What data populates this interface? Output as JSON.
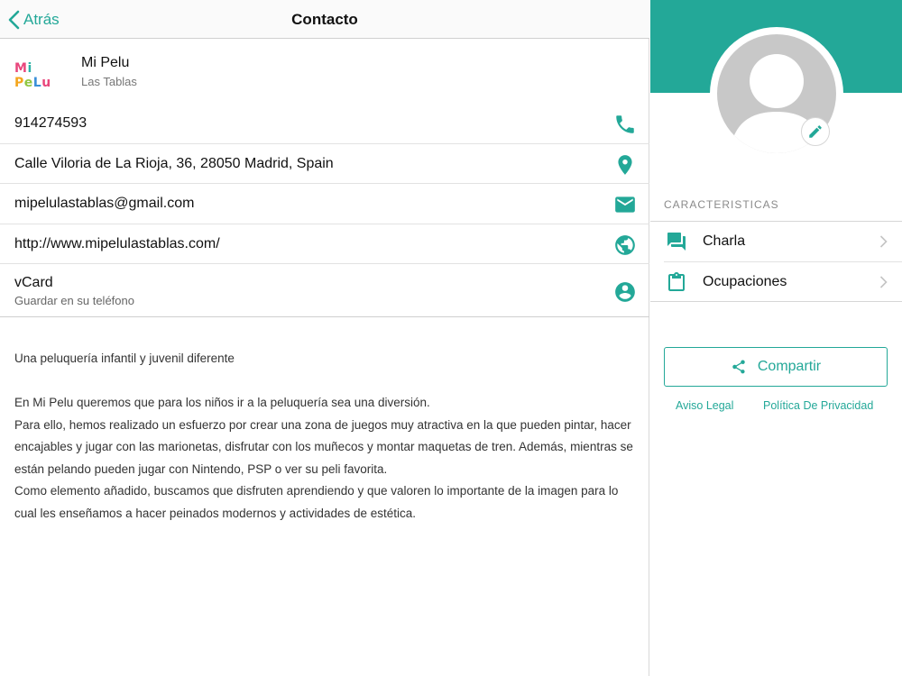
{
  "navbar": {
    "back_label": "Atrás",
    "title": "Contacto"
  },
  "business": {
    "logo_text": [
      "M",
      "i",
      " P",
      "e",
      "L",
      "u"
    ],
    "name": "Mi Pelu",
    "location": "Las Tablas"
  },
  "contact": {
    "phone": "914274593",
    "address": "Calle Viloria de La Rioja, 36, 28050 Madrid, Spain",
    "email": "mipelulastablas@gmail.com",
    "website": "http://www.mipelulastablas.com/",
    "vcard_title": "vCard",
    "vcard_sub": "Guardar en su teléfono"
  },
  "description": [
    "Una peluquería infantil y juvenil diferente",
    "En Mi Pelu queremos que para los niños ir a la peluquería sea una diversión.\nPara ello, hemos realizado un esfuerzo por crear una zona de juegos muy atractiva en la que pueden pintar, hacer encajables y jugar con las marionetas, disfrutar con los muñecos y montar maquetas de tren. Además, mientras se están pelando pueden jugar con Nintendo, PSP o ver su peli favorita.\nComo elemento añadido, buscamos que disfruten aprendiendo y que valoren lo importante de la imagen para lo cual les enseñamos a hacer peinados modernos y actividades de estética."
  ],
  "sidebar": {
    "section_title": "CARACTERISTICAS",
    "features": [
      {
        "label": "Charla",
        "icon": "chat-icon"
      },
      {
        "label": "Ocupaciones",
        "icon": "clipboard-icon"
      }
    ],
    "share_label": "Compartir",
    "legal_label": "Aviso Legal",
    "privacy_label": "Política De Privacidad"
  },
  "colors": {
    "accent": "#23a898"
  }
}
